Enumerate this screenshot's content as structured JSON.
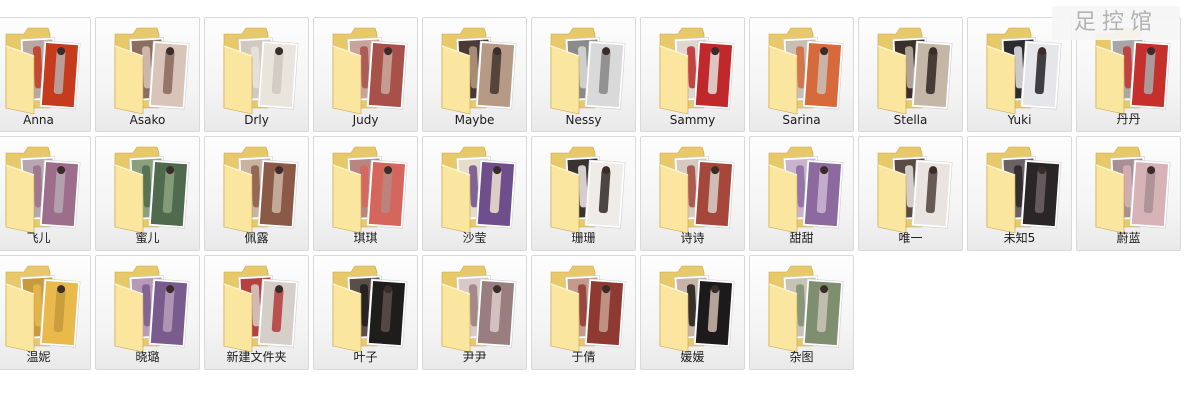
{
  "watermark": {
    "text": "足控馆"
  },
  "icon_name": "folder-icon",
  "colors": {
    "folder_back": "#e8c96a",
    "folder_front": "#fbe6a0",
    "folder_edge": "#c9a54a",
    "tile_border": "#d9d9d9"
  },
  "folders": [
    {
      "name": "Anna",
      "tones": [
        "#c63a1e",
        "#b7a8a3"
      ]
    },
    {
      "name": "Asako",
      "tones": [
        "#d8c4b8",
        "#8c6e5e"
      ]
    },
    {
      "name": "Drly",
      "tones": [
        "#e9e4dc",
        "#cfc9bf"
      ]
    },
    {
      "name": "Judy",
      "tones": [
        "#a8504a",
        "#c8a39a"
      ]
    },
    {
      "name": "Maybe",
      "tones": [
        "#b69a86",
        "#4b3a33"
      ]
    },
    {
      "name": "Nessy",
      "tones": [
        "#d9d9d9",
        "#8a8a8a"
      ]
    },
    {
      "name": "Sammy",
      "tones": [
        "#c0282c",
        "#e0d6d0"
      ]
    },
    {
      "name": "Sarina",
      "tones": [
        "#d66a3a",
        "#c9bdb4"
      ]
    },
    {
      "name": "Stella",
      "tones": [
        "#c4b7a8",
        "#3a2f2b"
      ]
    },
    {
      "name": "Yuki",
      "tones": [
        "#e6e6ea",
        "#2c2c30"
      ]
    },
    {
      "name": "丹丹",
      "tones": [
        "#c5302c",
        "#a8a6a6"
      ]
    },
    {
      "name": "飞儿",
      "tones": [
        "#9d6d8c",
        "#b5a6b0"
      ]
    },
    {
      "name": "蜜儿",
      "tones": [
        "#4f6a4c",
        "#8aa07d"
      ]
    },
    {
      "name": "佩露",
      "tones": [
        "#8b5a46",
        "#c9b2a0"
      ]
    },
    {
      "name": "琪琪",
      "tones": [
        "#d5665d",
        "#b88680"
      ]
    },
    {
      "name": "沙莹",
      "tones": [
        "#6e4f8c",
        "#e5dccc"
      ]
    },
    {
      "name": "珊珊",
      "tones": [
        "#efebe7",
        "#3a3431"
      ]
    },
    {
      "name": "诗诗",
      "tones": [
        "#a6473c",
        "#d6c9c0"
      ]
    },
    {
      "name": "甜甜",
      "tones": [
        "#8c6aa0",
        "#c9b4cf"
      ]
    },
    {
      "name": "唯一",
      "tones": [
        "#e9e4e0",
        "#5a4a44"
      ]
    },
    {
      "name": "未知5",
      "tones": [
        "#2a2628",
        "#6a6164"
      ]
    },
    {
      "name": "蔚蓝",
      "tones": [
        "#d7b3b8",
        "#a79094"
      ]
    },
    {
      "name": "温妮",
      "tones": [
        "#e9b94c",
        "#c79a3c"
      ]
    },
    {
      "name": "晓璐",
      "tones": [
        "#7a5b8e",
        "#b79ab8"
      ]
    },
    {
      "name": "新建文件夹",
      "tones": [
        "#d6cfc9",
        "#b64040"
      ]
    },
    {
      "name": "叶子",
      "tones": [
        "#1f1c1c",
        "#5a4e48"
      ]
    },
    {
      "name": "尹尹",
      "tones": [
        "#9a7d7f",
        "#d9c9c6"
      ]
    },
    {
      "name": "于倩",
      "tones": [
        "#8e3a32",
        "#c59a8a"
      ]
    },
    {
      "name": "媛媛",
      "tones": [
        "#1c1a1a",
        "#c7b3a8"
      ]
    },
    {
      "name": "杂图",
      "tones": [
        "#7d8f6e",
        "#c8c2b6"
      ]
    }
  ]
}
